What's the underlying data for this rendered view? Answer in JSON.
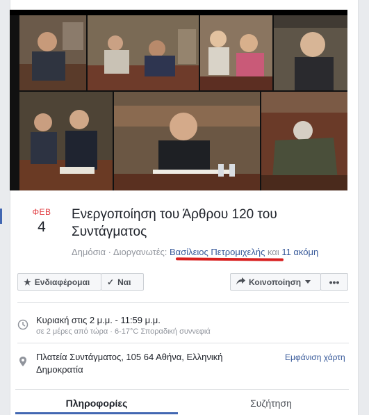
{
  "event": {
    "month": "ΦΕΒ",
    "day": "4",
    "title": "Ενεργοποίηση του Άρθρου 120 του Συντάγματος",
    "meta": {
      "visibility": "Δημόσια",
      "separator": " · ",
      "organizers_label": "Διοργανωτές: ",
      "organizer_name": "Βασίλειος Πετρομιχελής",
      "and_word": " και ",
      "others_link": "11 ακόμη"
    }
  },
  "actions": {
    "interested_label": "Ενδιαφέρομαι",
    "going_label": "Ναι",
    "share_label": "Κοινοποίηση",
    "more_label": "•••"
  },
  "details": {
    "time_main": "Κυριακή στις 2 μ.μ. - 11:59 μ.μ.",
    "time_sub": "σε 2 μέρες από τώρα · 6-17°C Σποραδική συννεφιά",
    "place": "Πλατεία Συντάγματος, 105 64 Αθήνα, Ελληνική Δημοκρατία",
    "map_link": "Εμφάνιση χάρτη"
  },
  "tabs": {
    "info": "Πληροφορίες",
    "discussion": "Συζήτηση"
  },
  "colors": {
    "link": "#365899",
    "month": "#e0393e",
    "accent": "#4267b2",
    "annotation": "#d81e1e"
  },
  "icons": {
    "interested": "star-icon",
    "going": "check-icon",
    "share": "share-arrow-icon",
    "more": "more-icon",
    "time": "clock-icon",
    "place": "location-pin-icon"
  }
}
